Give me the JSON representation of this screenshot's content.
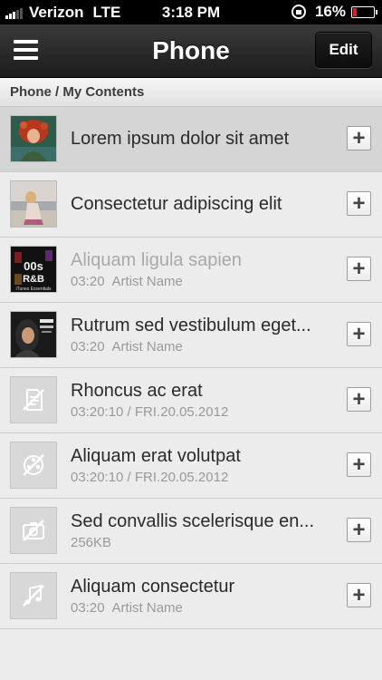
{
  "status_bar": {
    "carrier": "Verizon",
    "network": "LTE",
    "time": "3:18 PM",
    "battery": "16%"
  },
  "nav": {
    "title": "Phone",
    "edit_label": "Edit",
    "menu_icon": "hamburger-menu-icon"
  },
  "breadcrumb": "Phone / My Contents",
  "items": [
    {
      "title": "Lorem ipsum dolor sit amet",
      "subtitle": "",
      "thumb": "album-art-photo",
      "selected": true
    },
    {
      "title": "Consectetur adipiscing elit",
      "subtitle": "",
      "thumb": "beach-photo"
    },
    {
      "title": "Aliquam ligula sapien",
      "time": "03:20",
      "artist": "Artist Name",
      "thumb": "album-cover-rnb",
      "dimmed": true
    },
    {
      "title": "Rutrum sed vestibulum eget...",
      "time": "03:20",
      "artist": "Artist Name",
      "thumb": "album-cover-alicia"
    },
    {
      "title": "Rhoncus ac erat",
      "subtitle": "03:20:10 / FRI.20.05.2012",
      "thumb": "document-placeholder-icon"
    },
    {
      "title": "Aliquam erat volutpat",
      "subtitle": "03:20:10 / FRI.20.05.2012",
      "thumb": "video-reel-placeholder-icon"
    },
    {
      "title": "Sed convallis scelerisque en...",
      "subtitle": "256KB",
      "thumb": "photo-placeholder-icon"
    },
    {
      "title": "Aliquam consectetur",
      "time": "03:20",
      "artist": "Artist Name",
      "thumb": "music-placeholder-icon"
    }
  ],
  "add_button_symbol": "+",
  "colors": {
    "navbar": "#2a2a2a",
    "background": "#ececec",
    "selected_row": "#d5d5d5",
    "battery_low": "#e02020"
  }
}
